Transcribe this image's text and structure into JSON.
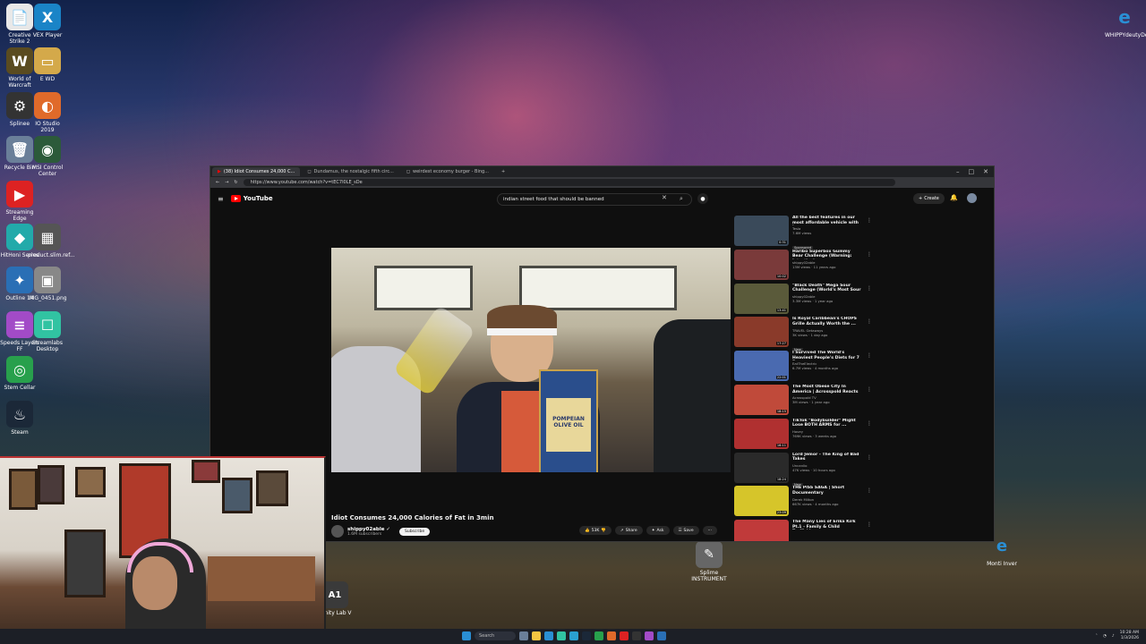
{
  "desktop": {
    "icons_left": [
      {
        "label": "Creative Strike 2",
        "glyph": "📄",
        "color": "#e8e8e8"
      },
      {
        "label": "VEX Player",
        "glyph": "X",
        "color": "#1a84c7"
      },
      {
        "label": "World of Warcraft",
        "glyph": "W",
        "color": "#5a4b20"
      },
      {
        "label": "E WD",
        "glyph": "▭",
        "color": "#d4a94a"
      },
      {
        "label": "Splinee",
        "glyph": "⚙",
        "color": "#333"
      },
      {
        "label": "IO Studio 2019",
        "glyph": "◐",
        "color": "#e06a2a"
      },
      {
        "label": "Recycle Bin",
        "glyph": "🗑",
        "color": "#6a7f99"
      },
      {
        "label": "MSI Control Center",
        "glyph": "◉",
        "color": "#2c5a3a"
      },
      {
        "label": "Streaming Edge",
        "glyph": "▶",
        "color": "#d22"
      },
      {
        "label": "HitHoni Series",
        "glyph": "◆",
        "color": "#2aa"
      },
      {
        "label": "product.slim.ref...",
        "glyph": "▦",
        "color": "#555"
      },
      {
        "label": "Outline 14",
        "glyph": "✦",
        "color": "#2a6fb5"
      },
      {
        "label": "IMG_0451.png",
        "glyph": "▣",
        "color": "#888"
      },
      {
        "label": "Speeds Layers FF",
        "glyph": "≡",
        "color": "#a24bc7"
      },
      {
        "label": "Streamlabs Desktop",
        "glyph": "☐",
        "color": "#31c3a2"
      },
      {
        "label": "Stem Cellar",
        "glyph": "◎",
        "color": "#28a04c"
      },
      {
        "label": "Steam",
        "glyph": "♨",
        "color": "#1b2838"
      }
    ],
    "icon_right": {
      "label": "WHIPPYdeutyDe...",
      "glyph": "e",
      "color": "#2a8fd4"
    },
    "icon_mid_left": {
      "label": "Lenity Lab V",
      "glyph": "A1",
      "color": "#333"
    },
    "icon_mid": {
      "label": "Splime INSTRUMENT",
      "glyph": "✎",
      "color": "#777"
    },
    "icon_mid_right": {
      "label": "Monti Inver",
      "glyph": "e",
      "color": "#2a8fd4"
    }
  },
  "browser": {
    "tabs": [
      {
        "label": "(38) Idiot Consumes 24,000 C...",
        "active": true
      },
      {
        "label": "Dundamus, the nostalgic fifth circ...",
        "active": false
      },
      {
        "label": "weirdest economy burger - Bing...",
        "active": false
      }
    ],
    "new_tab": "+",
    "url": "https://www.youtube.com/watch?v=tEC7I0LE_sDe",
    "win_controls": [
      "–",
      "□",
      "✕"
    ]
  },
  "youtube": {
    "logo": "YouTube",
    "search_query": "indian street food that should be banned",
    "clear": "✕",
    "search_icon": "⌕",
    "mic_icon": "🎤",
    "create_label": "Create",
    "notifications": "9+",
    "video": {
      "title": "Idiot Consumes 24,000 Calories of Fat in 3min",
      "channel": "shippy02able",
      "verified": "✓",
      "subs": "1.6M subscribers",
      "subscribe": "Subscribe",
      "likes": "53K",
      "share": "Share",
      "ask": "Ask",
      "save": "Save",
      "more": "···",
      "bottle_text": "POMPEIAN OLIVE OIL"
    },
    "recommendations": [
      {
        "title": "All the best features in our most affordable vehicle with low co...",
        "channel": "Tesla",
        "stats": "7.6M views",
        "badge": "Sponsored",
        "duration": "0:31",
        "color": "#3a4a5a"
      },
      {
        "title": "Haribo Superbox Gummy Bear Challenge (Warning: Intestinal ...",
        "channel": "shippy02able",
        "stats": "13M views · 11 years ago",
        "badge": "",
        "duration": "10:02",
        "color": "#7a3a3a"
      },
      {
        "title": "\"Black Death\" Mega Sour Challenge (World's Most Sour ...",
        "channel": "shippy02able",
        "stats": "3.3M views · 1 year ago",
        "badge": "",
        "duration": "13:41",
        "color": "#5a5a3a"
      },
      {
        "title": "Is Royal Caribbean's CHOPS Grille Actually Worth the ...",
        "channel": "TRAVEL Getaways",
        "stats": "3K views · 1 day ago",
        "badge": "New",
        "duration": "17:27",
        "color": "#8a3a2a"
      },
      {
        "title": "I Survived The World's Heaviest People's Diets for 7 Days",
        "channel": "EatTheElectric",
        "stats": "6.7M views · 4 months ago",
        "badge": "",
        "duration": "22:01",
        "color": "#4a6ab0"
      },
      {
        "title": "The Most Obese City In America | Acrosspold Reacts",
        "channel": "Acrosspold TV",
        "stats": "3M views · 1 year ago",
        "badge": "",
        "duration": "18:15",
        "color": "#c04a3a"
      },
      {
        "title": "TikTok \"Bodybuilder\" Might Lose BOTH ARMS for ...",
        "channel": "Hovey",
        "stats": "769K views · 3 weeks ago",
        "badge": "",
        "duration": "16:11",
        "color": "#b03030"
      },
      {
        "title": "Lord Jemor - The King of Bad Takes",
        "channel": "Uncanlio",
        "stats": "47K views · 10 hours ago",
        "badge": "New",
        "duration": "18:24",
        "color": "#2a2a2a"
      },
      {
        "title": "THE PISS SAGA | Short Documentary",
        "channel": "Derek Milton",
        "stats": "667K views · 4 months ago",
        "badge": "",
        "duration": "23:09",
        "color": "#d6c52a"
      },
      {
        "title": "The Many Lies of Erika Kirk Pt.1 - Family & Child Trafficking",
        "channel": "",
        "stats": "",
        "badge": "",
        "duration": "",
        "color": "#c03a3a"
      }
    ]
  },
  "taskbar": {
    "search": "Search",
    "time": "10:28 AM",
    "date": "1/3/2026",
    "apps": [
      "#6a7f99",
      "#f4c542",
      "#2a8fd4",
      "#31c3a2",
      "#2aa0d0",
      "#1b2838",
      "#28a04c",
      "#e06a2a",
      "#d22",
      "#333",
      "#a24bc7",
      "#2a6fb5"
    ]
  }
}
